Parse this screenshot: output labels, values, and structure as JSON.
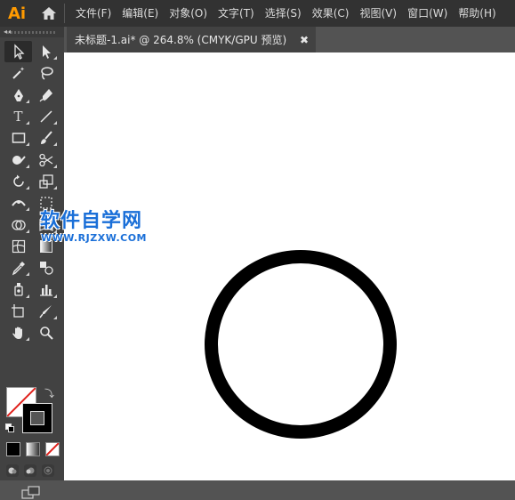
{
  "app": {
    "logo": "Ai"
  },
  "menu": [
    "文件(F)",
    "编辑(E)",
    "对象(O)",
    "文字(T)",
    "选择(S)",
    "效果(C)",
    "视图(V)",
    "窗口(W)",
    "帮助(H)"
  ],
  "document": {
    "tab_title": "未标题-1.ai* @ 264.8% (CMYK/GPU 预览)",
    "close_glyph": "✖"
  },
  "toolbar": {
    "collapse_glyph": "◂◂",
    "type_tool_glyph": "T",
    "swap_glyph": "⤵"
  },
  "watermark": {
    "title": "软件自学网",
    "url": "WWW.RJZXW.COM"
  },
  "colors": {
    "menubar_bg": "#323232",
    "toolbar_bg": "#424242",
    "workspace_bg": "#535353",
    "logo_color": "#ff9a00",
    "watermark_blue": "#1a6fd8"
  }
}
